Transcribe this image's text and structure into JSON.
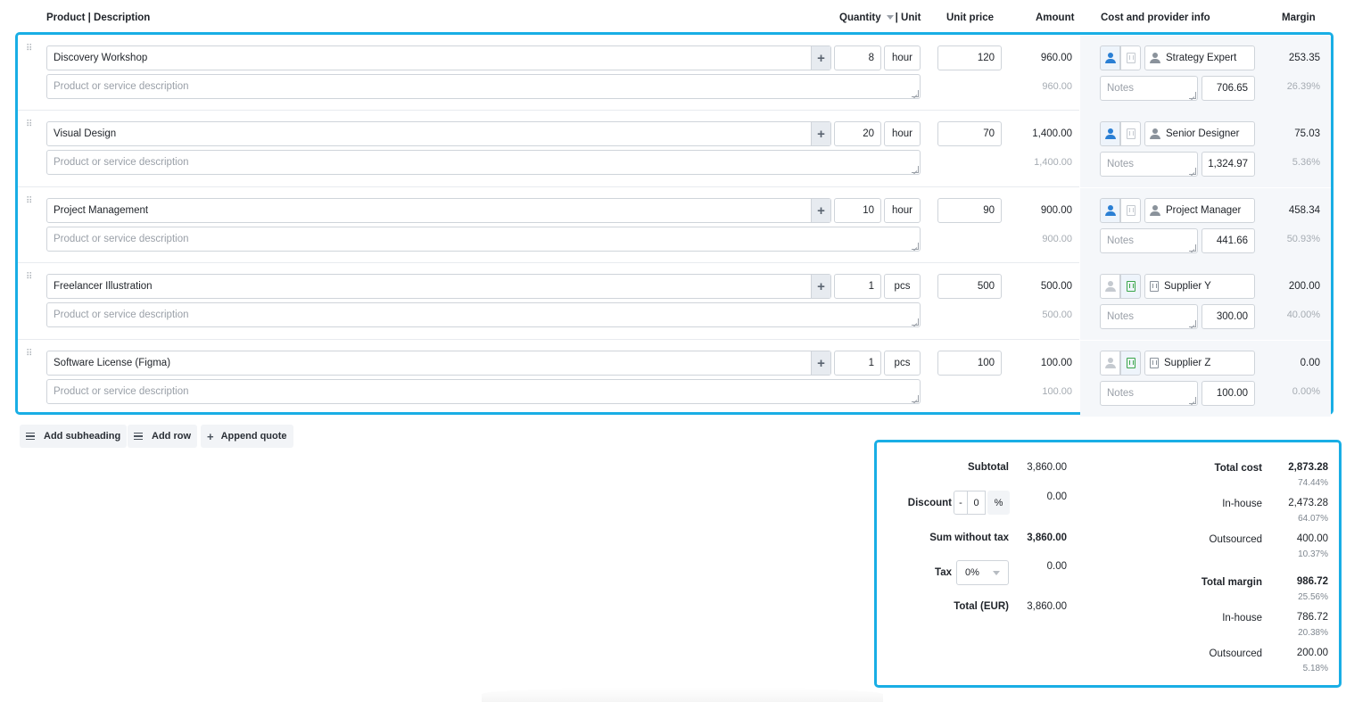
{
  "header": {
    "product_desc": "Product | Description",
    "quantity": "Quantity",
    "unit": "| Unit",
    "unit_price": "Unit price",
    "amount": "Amount",
    "cost_provider": "Cost and provider info",
    "margin": "Margin"
  },
  "rows": [
    {
      "name": "Discovery Workshop",
      "desc_placeholder": "Product or service description",
      "qty": "8",
      "unit": "hour",
      "price": "120",
      "amount": "960.00",
      "amount_sub": "960.00",
      "provider_type": "person",
      "provider": "Strategy Expert",
      "notes_placeholder": "Notes",
      "cost": "706.65",
      "margin": "253.35",
      "margin_pct": "26.39%"
    },
    {
      "name": "Visual Design",
      "desc_placeholder": "Product or service description",
      "qty": "20",
      "unit": "hour",
      "price": "70",
      "amount": "1,400.00",
      "amount_sub": "1,400.00",
      "provider_type": "person",
      "provider": "Senior Designer",
      "notes_placeholder": "Notes",
      "cost": "1,324.97",
      "margin": "75.03",
      "margin_pct": "5.36%"
    },
    {
      "name": "Project Management",
      "desc_placeholder": "Product or service description",
      "qty": "10",
      "unit": "hour",
      "price": "90",
      "amount": "900.00",
      "amount_sub": "900.00",
      "provider_type": "person",
      "provider": "Project Manager",
      "notes_placeholder": "Notes",
      "cost": "441.66",
      "margin": "458.34",
      "margin_pct": "50.93%"
    },
    {
      "name": "Freelancer Illustration",
      "desc_placeholder": "Product or service description",
      "qty": "1",
      "unit": "pcs",
      "price": "500",
      "amount": "500.00",
      "amount_sub": "500.00",
      "provider_type": "company",
      "provider": "Supplier Y",
      "notes_placeholder": "Notes",
      "cost": "300.00",
      "margin": "200.00",
      "margin_pct": "40.00%"
    },
    {
      "name": "Software License (Figma)",
      "desc_placeholder": "Product or service description",
      "qty": "1",
      "unit": "pcs",
      "price": "100",
      "amount": "100.00",
      "amount_sub": "100.00",
      "provider_type": "company",
      "provider": "Supplier Z",
      "notes_placeholder": "Notes",
      "cost": "100.00",
      "margin": "0.00",
      "margin_pct": "0.00%"
    }
  ],
  "actions": {
    "add_subheading": "Add subheading",
    "add_row": "Add row",
    "append_quote": "Append quote"
  },
  "totals": {
    "subtotal_label": "Subtotal",
    "subtotal": "3,860.00",
    "discount_label": "Discount",
    "discount_sign": "-",
    "discount_value": "0",
    "discount_unit": "%",
    "discount_amount": "0.00",
    "sum_wo_tax_label": "Sum without tax",
    "sum_wo_tax": "3,860.00",
    "tax_label": "Tax",
    "tax_selected": "0%",
    "tax_amount": "0.00",
    "total_label": "Total (EUR)",
    "total": "3,860.00"
  },
  "costs": {
    "total_cost_label": "Total cost",
    "total_cost": "2,873.28",
    "total_cost_pct": "74.44%",
    "inhouse_label": "In-house",
    "inhouse": "2,473.28",
    "inhouse_pct": "64.07%",
    "outsourced_label": "Outsourced",
    "outsourced": "400.00",
    "outsourced_pct": "10.37%",
    "total_margin_label": "Total margin",
    "total_margin": "986.72",
    "total_margin_pct": "25.56%",
    "margin_inhouse_label": "In-house",
    "margin_inhouse": "786.72",
    "margin_inhouse_pct": "20.38%",
    "margin_outsourced_label": "Outsourced",
    "margin_outsourced": "200.00",
    "margin_outsourced_pct": "5.18%"
  },
  "colors": {
    "highlight": "#19aee5",
    "person_active": "#2a7fd4",
    "company_active": "#3aa64a",
    "inactive_icon": "#c5cad0"
  }
}
